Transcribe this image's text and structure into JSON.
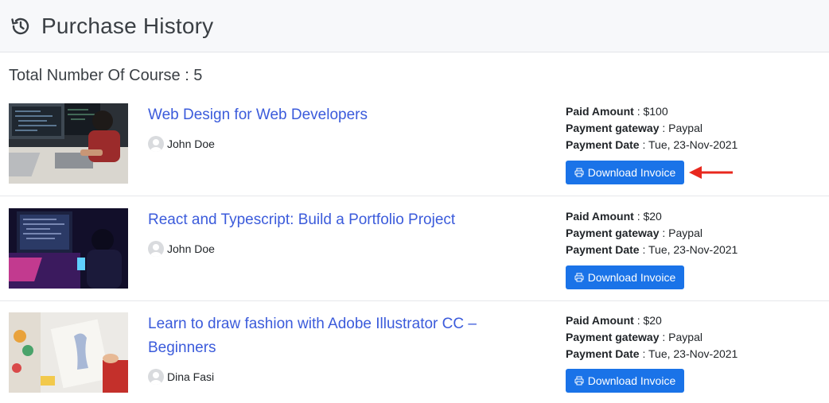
{
  "header": {
    "title": "Purchase History",
    "icon": "history-icon"
  },
  "summary": {
    "total_label": "Total Number Of Course : 5"
  },
  "labels": {
    "paid_amount": "Paid Amount",
    "payment_gateway": "Payment gateway",
    "payment_date": "Payment Date",
    "separator": " : "
  },
  "courses": [
    {
      "title": "Web Design for Web Developers",
      "author": "John Doe",
      "paid_amount": "$100",
      "payment_gateway": "Paypal",
      "payment_date": "Tue, 23-Nov-2021",
      "download_label": "Download Invoice"
    },
    {
      "title": "React and Typescript: Build a Portfolio Project",
      "author": "John Doe",
      "paid_amount": "$20",
      "payment_gateway": "Paypal",
      "payment_date": "Tue, 23-Nov-2021",
      "download_label": "Download Invoice"
    },
    {
      "title": "Learn to draw fashion with Adobe Illustrator CC – Beginners",
      "author": "Dina Fasi",
      "paid_amount": "$20",
      "payment_gateway": "Paypal",
      "payment_date": "Tue, 23-Nov-2021",
      "download_label": "Download Invoice"
    }
  ],
  "colors": {
    "link": "#3b5bdb",
    "button": "#1a73e8",
    "arrow": "#e8281e",
    "header_bg": "#f7f8fa"
  }
}
